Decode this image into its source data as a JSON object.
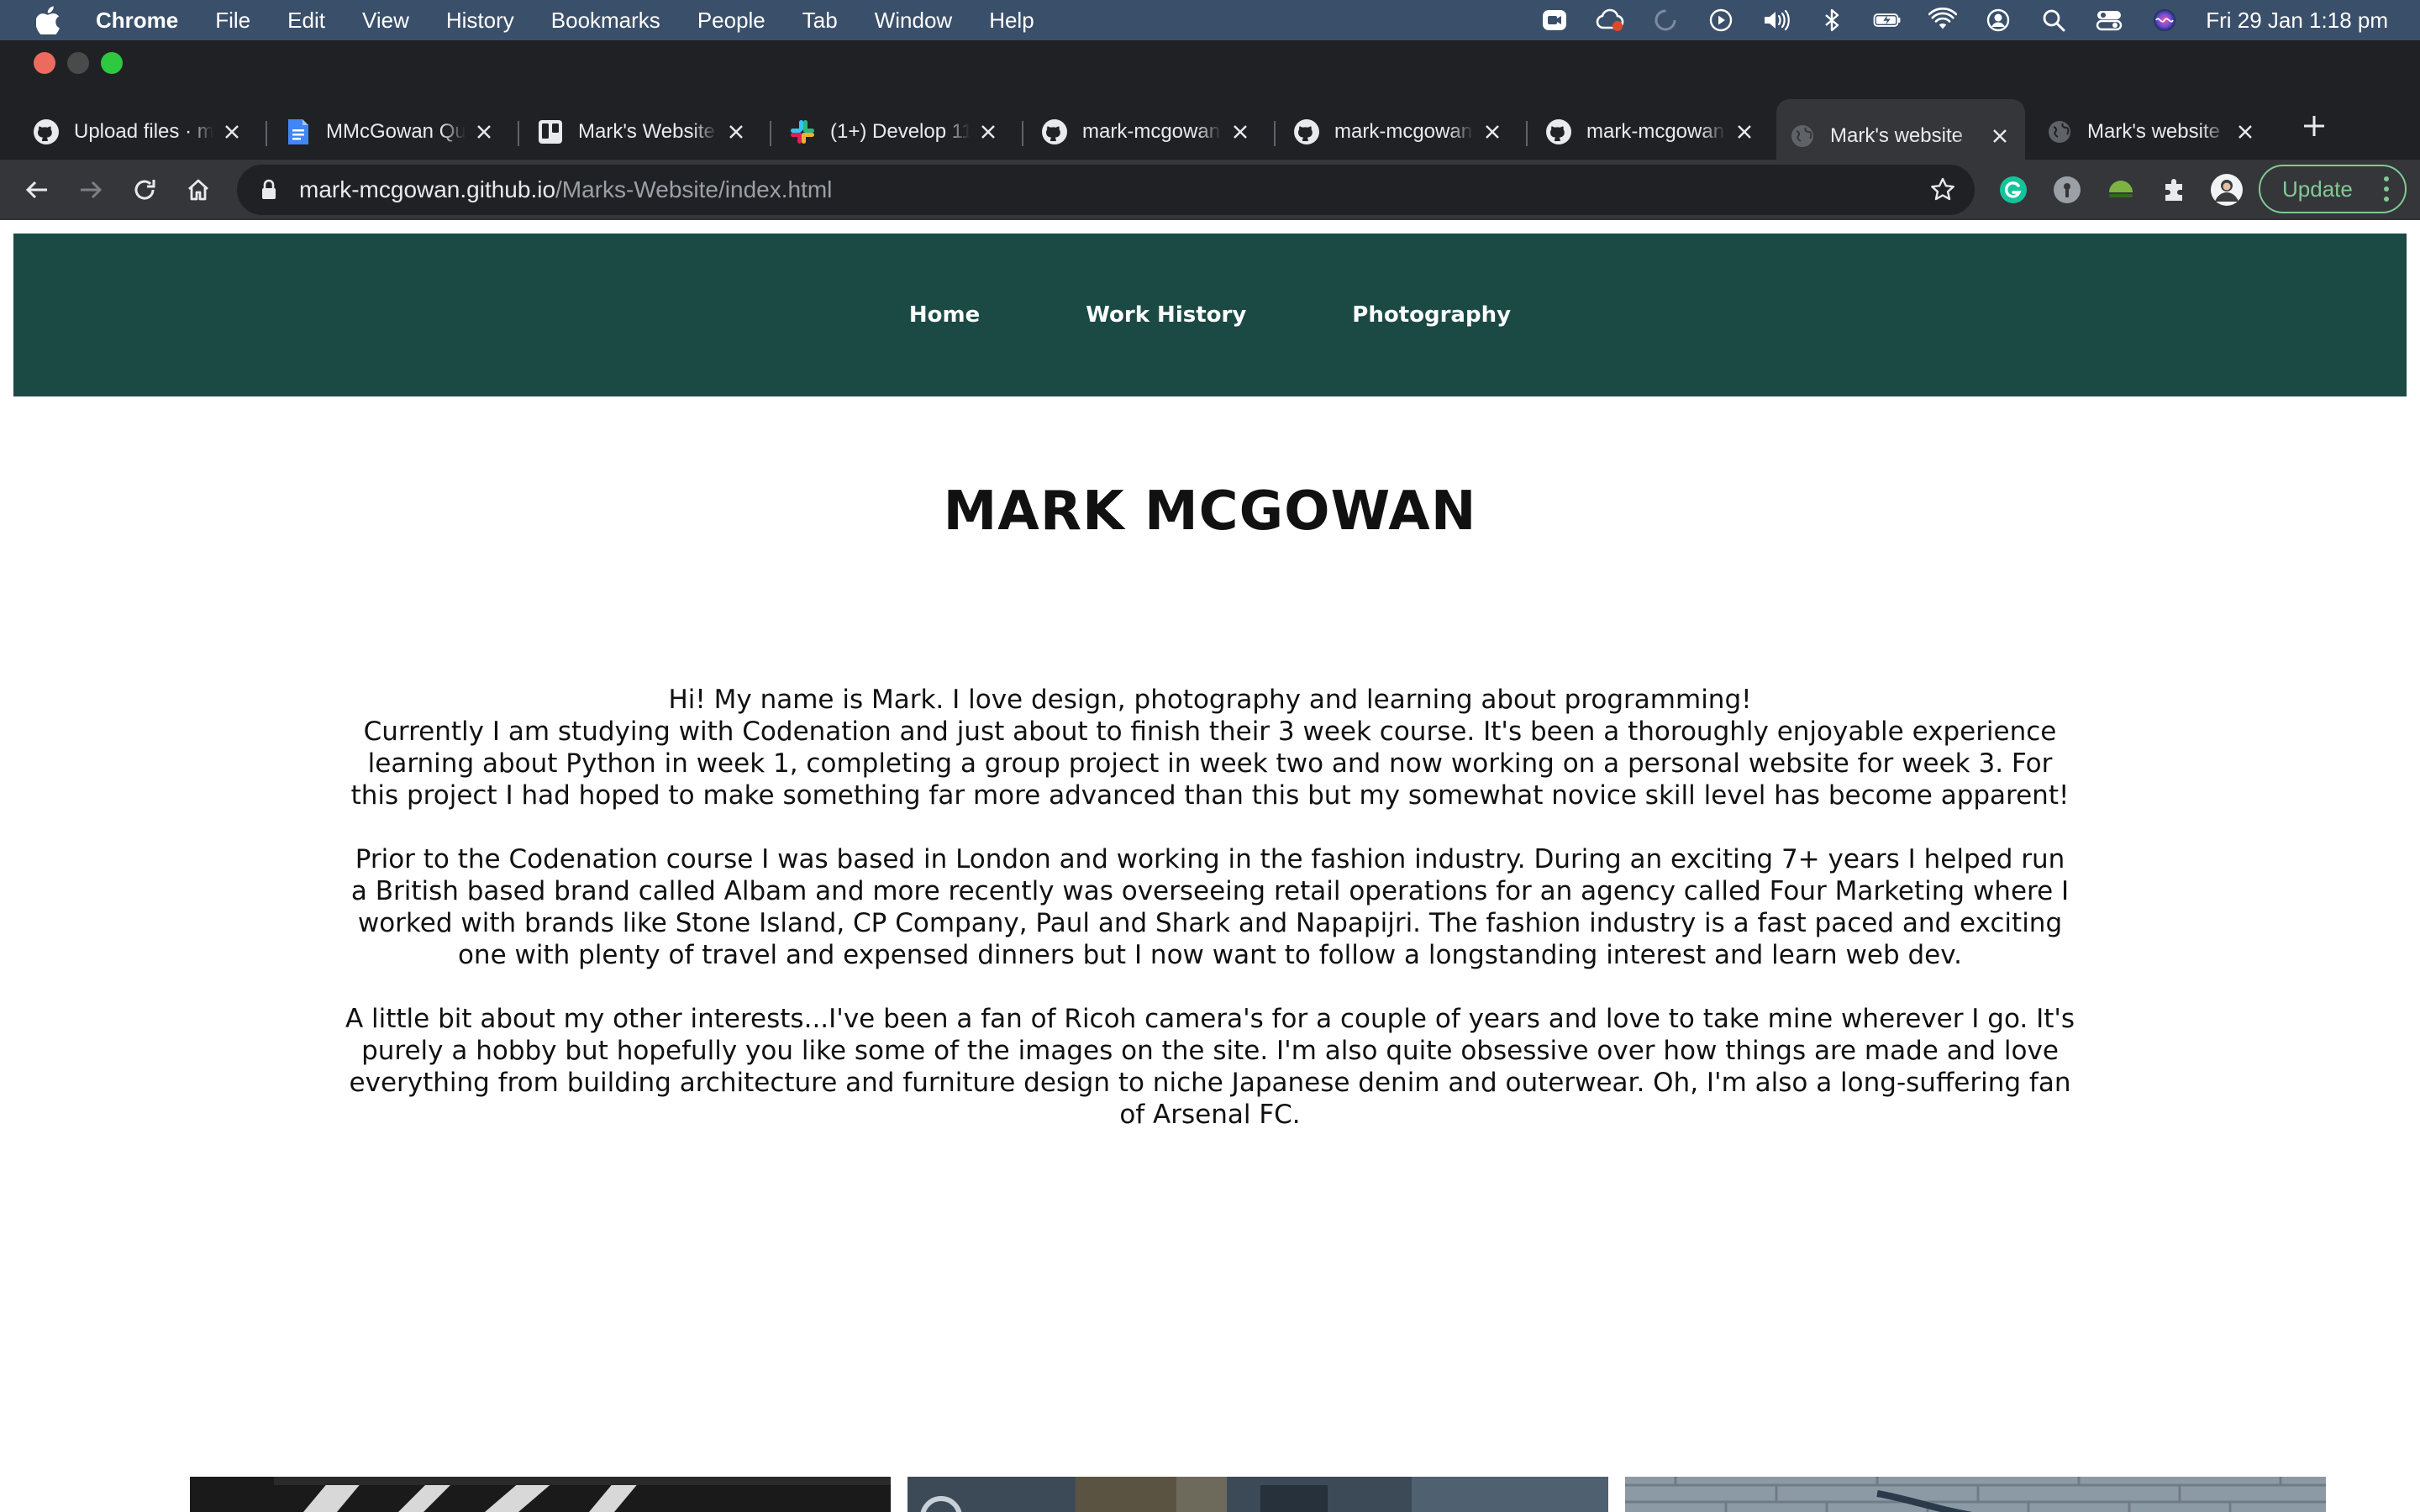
{
  "menubar": {
    "app_name": "Chrome",
    "items": [
      "File",
      "Edit",
      "View",
      "History",
      "Bookmarks",
      "People",
      "Tab",
      "Window",
      "Help"
    ],
    "clock": "Fri 29 Jan  1:18 pm"
  },
  "tabs": [
    {
      "title": "Upload files · m",
      "icon": "github-icon"
    },
    {
      "title": "MMcGowan Qu",
      "icon": "google-docs-icon"
    },
    {
      "title": "Mark's Website",
      "icon": "trello-icon"
    },
    {
      "title": "(1+) Develop 11",
      "icon": "slack-icon"
    },
    {
      "title": "mark-mcgowan",
      "icon": "github-icon"
    },
    {
      "title": "mark-mcgowan",
      "icon": "github-icon"
    },
    {
      "title": "mark-mcgowan",
      "icon": "github-icon"
    },
    {
      "title": "Mark's website",
      "icon": "globe-icon",
      "active": true
    },
    {
      "title": "Mark's website",
      "icon": "globe-icon"
    }
  ],
  "address": {
    "host": "mark-mcgowan.github.io",
    "path": "/Marks-Website/index.html"
  },
  "toolbar": {
    "update_label": "Update"
  },
  "site": {
    "nav": [
      "Home",
      "Work History",
      "Photography"
    ],
    "title": "MARK MCGOWAN",
    "bio": [
      "Hi! My name is Mark. I love design, photography and learning about programming!",
      "Currently I am studying with Codenation and just about to finish their 3 week course. It's been a thoroughly enjoyable experience learning about Python in week 1, completing a group project in week two and now working on a personal website for week 3. For this project I had hoped to make something far more advanced than this but my somewhat novice skill level has become apparent!",
      "Prior to the Codenation course I was based in London and working in the fashion industry. During an exciting 7+ years I helped run a British based brand called Albam and more recently was overseeing retail operations for an agency called Four Marketing where I worked with brands like Stone Island, CP Company, Paul and Shark and Napapijri. The fashion industry is a fast paced and exciting one with plenty of travel and expensed dinners but I now want to follow a longstanding interest and learn web dev.",
      "A little bit about my other interests...I've been a fan of Ricoh camera's for a couple of years and love to take mine wherever I go. It's purely a hobby but hopefully you like some of the images on the site. I'm also quite obsessive over how things are made and love everything from building architecture and furniture design to niche Japanese denim and outerwear. Oh, I'm also a long-suffering fan of Arsenal FC."
    ]
  },
  "colors": {
    "menubar": "#3a4f6a",
    "chrome_dark": "#202124",
    "chrome_toolbar": "#35363a",
    "site_nav": "#1b4a45",
    "update_green": "#81c995"
  }
}
